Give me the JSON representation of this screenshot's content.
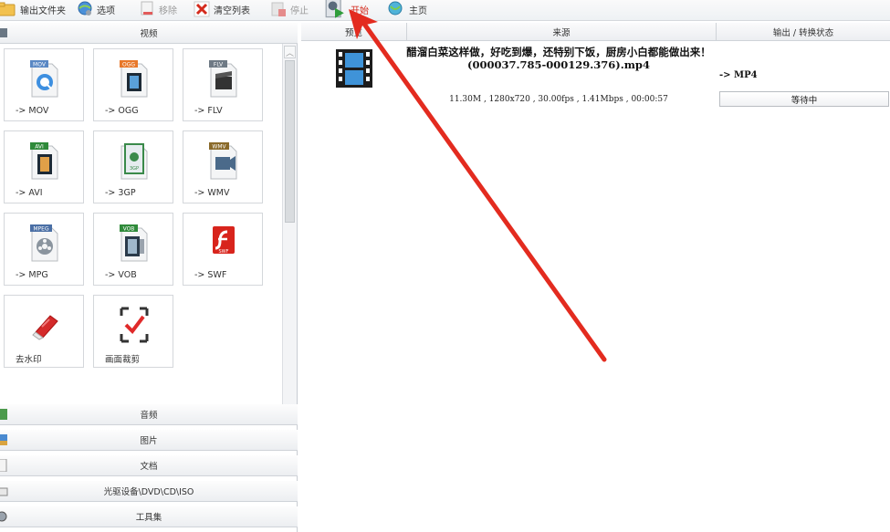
{
  "toolbar": {
    "output_folder": "输出文件夹",
    "options": "选项",
    "remove": "移除",
    "clear_list": "清空列表",
    "stop": "停止",
    "start": "开始",
    "home": "主页"
  },
  "left_panel": {
    "video_header": "视频",
    "tiles": [
      {
        "label": "-> MOV",
        "badge": "MOV",
        "icon": "mov-file-icon"
      },
      {
        "label": "-> OGG",
        "badge": "OGG",
        "icon": "ogg-file-icon"
      },
      {
        "label": "-> FLV",
        "badge": "FLV",
        "icon": "flv-file-icon"
      },
      {
        "label": "-> AVI",
        "badge": "AVI",
        "icon": "avi-file-icon"
      },
      {
        "label": "-> 3GP",
        "badge": "3GP",
        "icon": "3gp-file-icon"
      },
      {
        "label": "-> WMV",
        "badge": "WMV",
        "icon": "wmv-file-icon"
      },
      {
        "label": "-> MPG",
        "badge": "MPEG",
        "icon": "mpeg-file-icon"
      },
      {
        "label": "-> VOB",
        "badge": "VOB",
        "icon": "vob-file-icon"
      },
      {
        "label": "-> SWF",
        "badge": "SWF",
        "icon": "swf-file-icon"
      },
      {
        "label": "去水印",
        "badge": "",
        "icon": "eraser-icon"
      },
      {
        "label": "画面裁剪",
        "badge": "",
        "icon": "crop-icon"
      }
    ],
    "categories": [
      "音频",
      "图片",
      "文档",
      "光驱设备\\DVD\\CD\\ISO",
      "工具集"
    ]
  },
  "table": {
    "col_preview": "预览",
    "col_source": "来源",
    "col_output": "输出 / 转换状态"
  },
  "task": {
    "source_title": "醋溜白菜这样做，好吃到爆，还特别下饭，厨房小白都能做出来！(000037.785-000129.376).mp4",
    "source_info": "11.30M , 1280x720 , 30.00fps , 1.41Mbps , 00:00:57",
    "output_format": "-> MP4",
    "status": "等待中"
  },
  "colors": {
    "accent_red": "#e32b1f",
    "badge_orange": "#e8782a",
    "badge_blue": "#5a88c4",
    "badge_green": "#2f8a3a"
  }
}
